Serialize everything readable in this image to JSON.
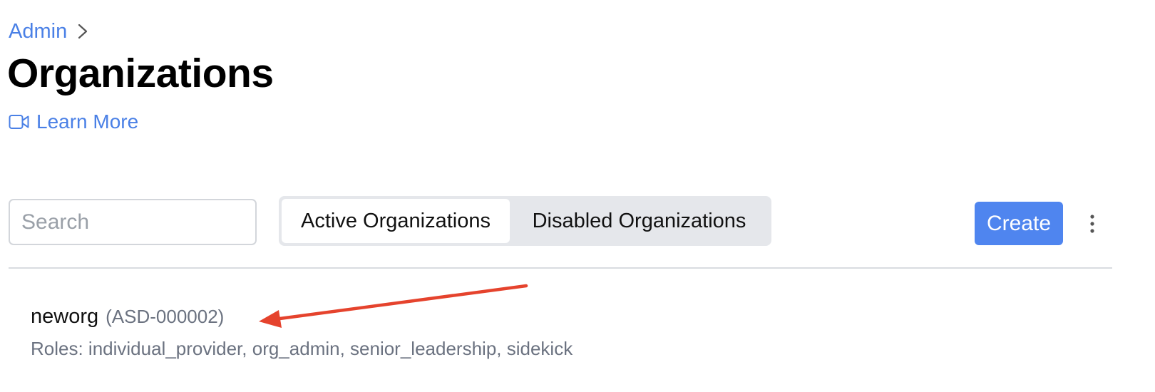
{
  "breadcrumb": {
    "parent_label": "Admin"
  },
  "page": {
    "title": "Organizations",
    "learn_more_label": "Learn More"
  },
  "toolbar": {
    "search_placeholder": "Search",
    "search_value": "",
    "tabs": [
      {
        "label": "Active Organizations",
        "selected": true
      },
      {
        "label": "Disabled Organizations",
        "selected": false
      }
    ],
    "create_label": "Create"
  },
  "organizations": [
    {
      "name": "neworg",
      "id": "(ASD-000002)",
      "roles": "Roles: individual_provider, org_admin, senior_leadership, sidekick"
    }
  ],
  "icons": {
    "breadcrumb_separator": "chevron-right-icon",
    "learn_more": "video-camera-icon",
    "more_menu": "vertical-ellipsis-icon",
    "annotation": "arrow-annotation"
  },
  "colors": {
    "accent": "#4a80e6",
    "button_primary": "#4f85ef",
    "annotation": "#e5432d",
    "muted_text": "#6b7280",
    "segment_background": "#e5e7eb"
  }
}
